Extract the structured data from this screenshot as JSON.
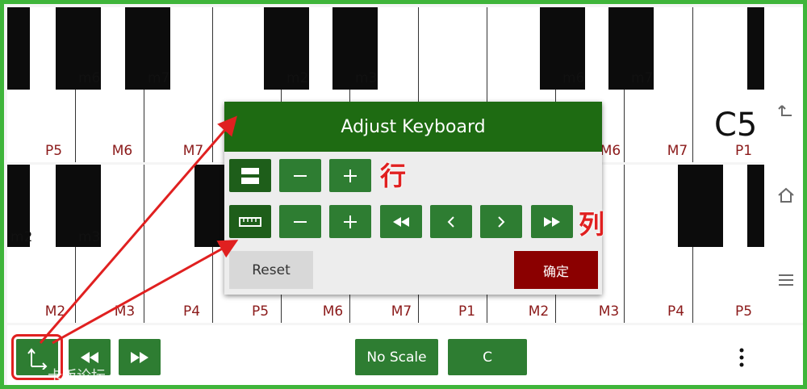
{
  "keyboard_top": {
    "black_labels": [
      "m6",
      "m7",
      "m2",
      "m3",
      "m6",
      "m7"
    ],
    "intervals": [
      "P5",
      "M6",
      "M7",
      "M6",
      "M7",
      "P1"
    ],
    "note": "C5"
  },
  "keyboard_bottom": {
    "black_labels": [
      "m2",
      "m3"
    ],
    "intervals": [
      "M2",
      "M3",
      "P4",
      "P5",
      "M6",
      "M7",
      "P1",
      "M2",
      "M3",
      "P4",
      "P5"
    ]
  },
  "dialog": {
    "title": "Adjust Keyboard",
    "reset_label": "Reset",
    "confirm_label": "确定",
    "row_label": "行",
    "column_label": "列"
  },
  "bottom_bar": {
    "scale_label": "No Scale",
    "key_label": "C"
  },
  "watermark": "卡饭论坛",
  "colors": {
    "accent_green": "#2e7d32",
    "header_green": "#1e6b12",
    "confirm_red": "#8b0000",
    "frame_green": "#3fb53a",
    "annotation_red": "#e02020",
    "interval_text": "#8b1a1a"
  },
  "icons": [
    "rows-icon",
    "ruler-icon",
    "minus-icon",
    "plus-icon",
    "rewind-icon",
    "chevron-left-icon",
    "chevron-right-icon",
    "fast-forward-icon",
    "adjust-keyboard-icon",
    "more-vert-icon",
    "back-icon",
    "home-icon",
    "menu-icon"
  ]
}
